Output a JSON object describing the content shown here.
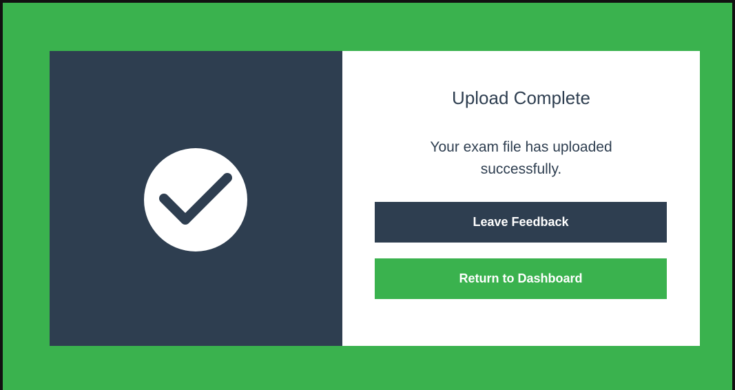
{
  "colors": {
    "background_green": "#3ab24e",
    "panel_navy": "#2e3e50",
    "panel_white": "#ffffff"
  },
  "status_panel": {
    "icon": "checkmark-circle-icon"
  },
  "dialog": {
    "title": "Upload Complete",
    "message": "Your exam file has uploaded successfully.",
    "feedback_button_label": "Leave Feedback",
    "dashboard_button_label": "Return to Dashboard"
  }
}
